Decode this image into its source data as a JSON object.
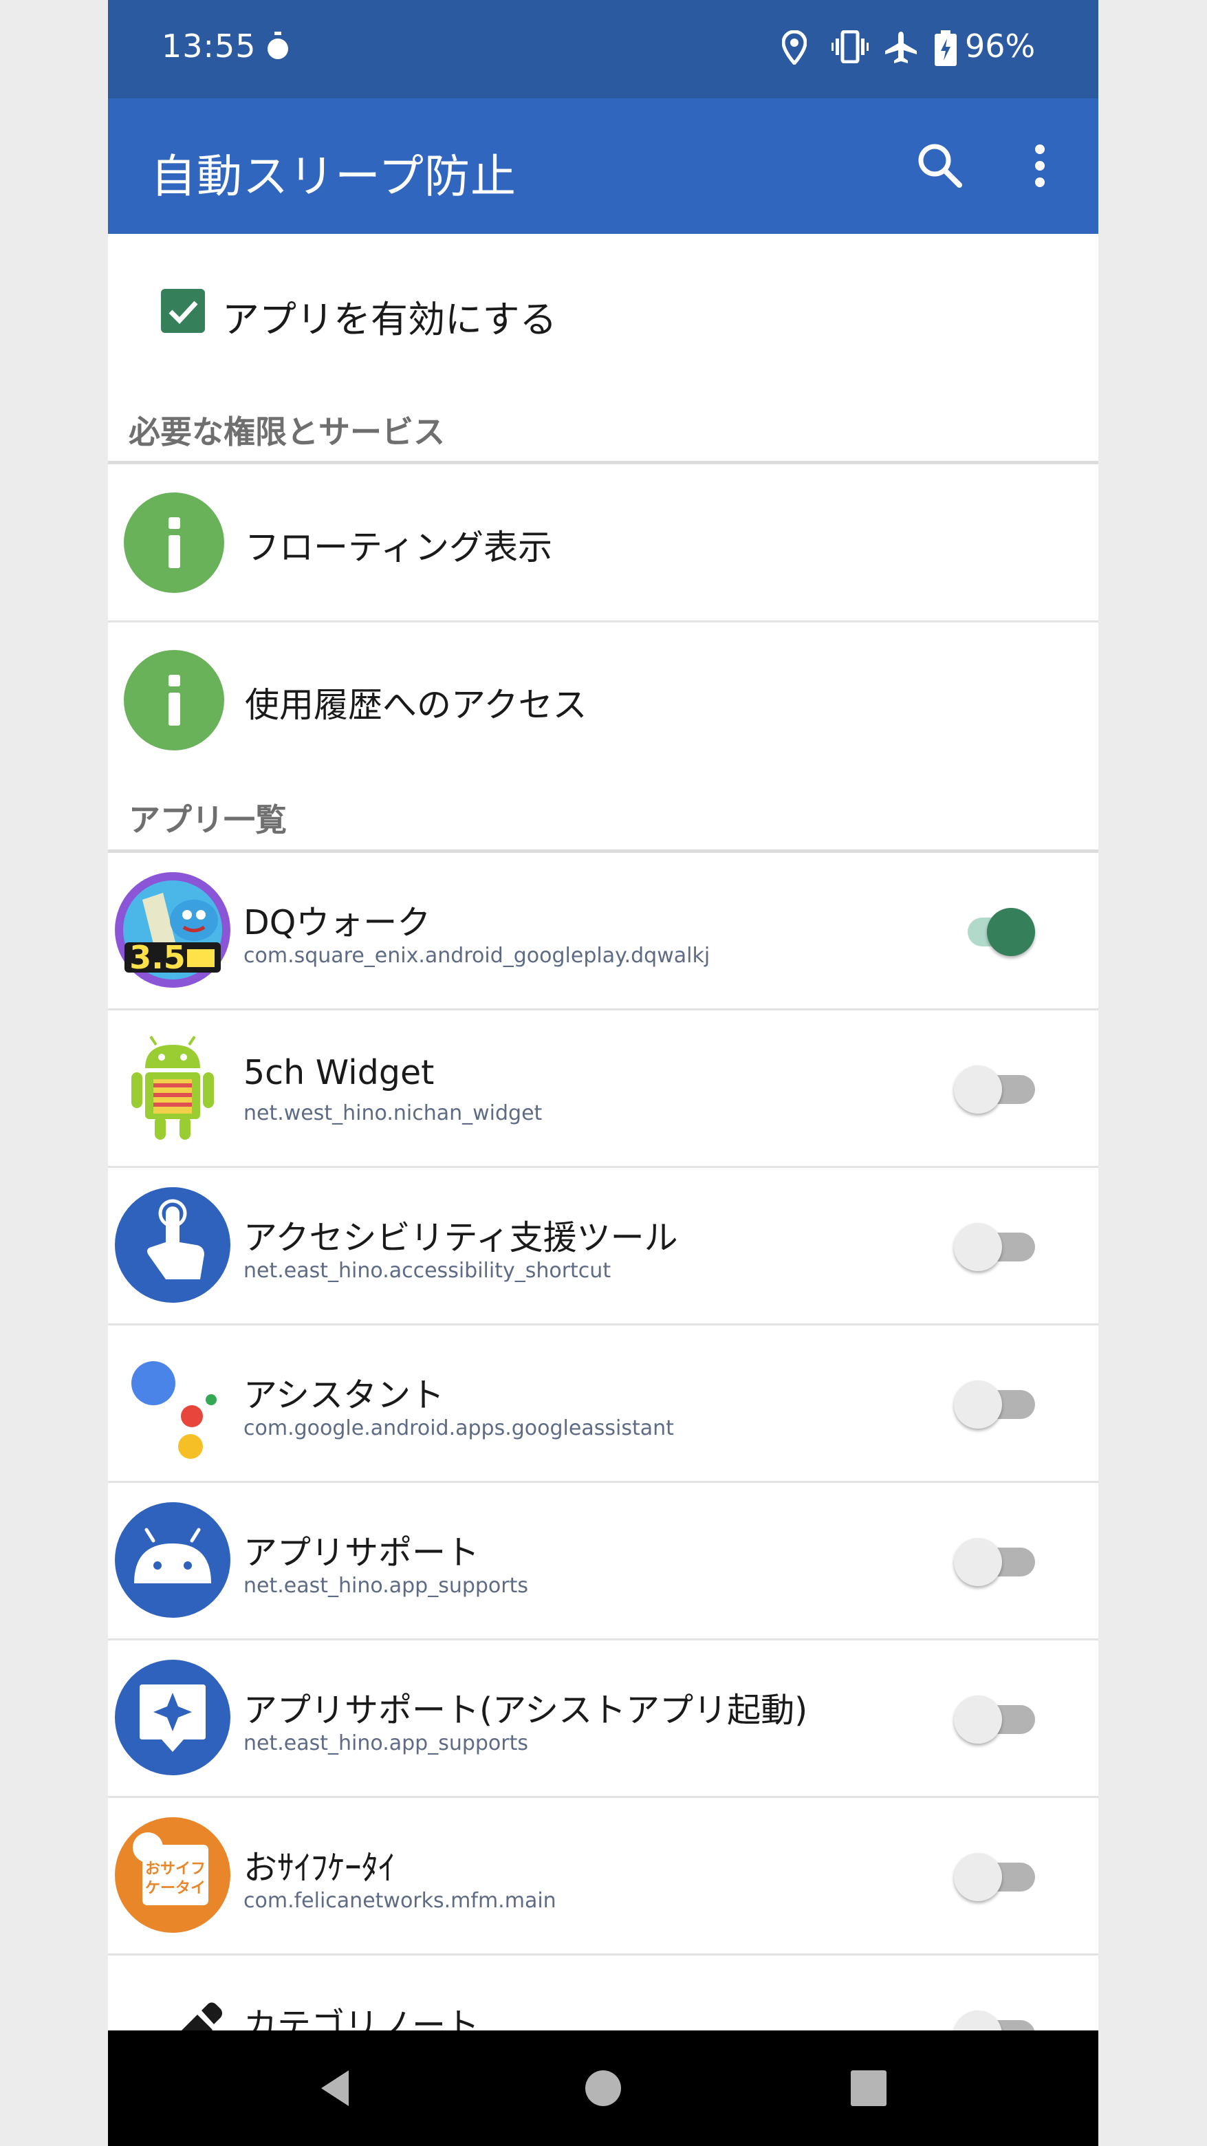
{
  "status_bar": {
    "time": "13:55",
    "battery": "96%",
    "icons": [
      "timer-icon",
      "location-icon",
      "vibrate-icon",
      "airplane-icon",
      "battery-charging-icon"
    ]
  },
  "app_bar": {
    "title": "自動スリープ防止",
    "actions": [
      "search-icon",
      "more-vert-icon"
    ]
  },
  "enable": {
    "checked": true,
    "label": "アプリを有効にする"
  },
  "sections": {
    "permissions_header": "必要な権限とサービス",
    "apps_header": "アプリ一覧"
  },
  "permissions": [
    {
      "label": "フローティング表示",
      "icon": "info-icon"
    },
    {
      "label": "使用履歴へのアクセス",
      "icon": "info-icon"
    }
  ],
  "apps": [
    {
      "name": "DQウォーク",
      "package": "com.square_enix.android_googleplay.dqwalkj",
      "enabled": true,
      "icon": "dq-walk-icon",
      "badge": "3.5"
    },
    {
      "name": "5ch Widget",
      "package": "net.west_hino.nichan_widget",
      "enabled": false,
      "icon": "android-robot-icon"
    },
    {
      "name": "アクセシビリティ支援ツール",
      "package": "net.east_hino.accessibility_shortcut",
      "enabled": false,
      "icon": "touch-hand-icon"
    },
    {
      "name": "アシスタント",
      "package": "com.google.android.apps.googleassistant",
      "enabled": false,
      "icon": "google-assistant-icon"
    },
    {
      "name": "アプリサポート",
      "package": "net.east_hino.app_supports",
      "enabled": false,
      "icon": "android-head-icon"
    },
    {
      "name": "アプリサポート(アシストアプリ起動)",
      "package": "net.east_hino.app_supports",
      "enabled": false,
      "icon": "assist-sparkle-icon"
    },
    {
      "name": "おｻｲﾌｹｰﾀｲ",
      "package": "com.felicanetworks.mfm.main",
      "enabled": false,
      "icon": "osaifu-keitai-icon",
      "icon_text": "おサイフ\nケータイ"
    },
    {
      "name": "カテゴリノート",
      "package": "",
      "enabled": false,
      "icon": "pencil-icon"
    }
  ],
  "colors": {
    "status_bar": "#2c5aa0",
    "app_bar": "#3166bf",
    "accent_green": "#35805a",
    "info_green": "#69b25a",
    "package_text": "#5e6b84"
  },
  "nav_bar": {
    "buttons": [
      "back-icon",
      "home-icon",
      "recents-icon"
    ]
  }
}
